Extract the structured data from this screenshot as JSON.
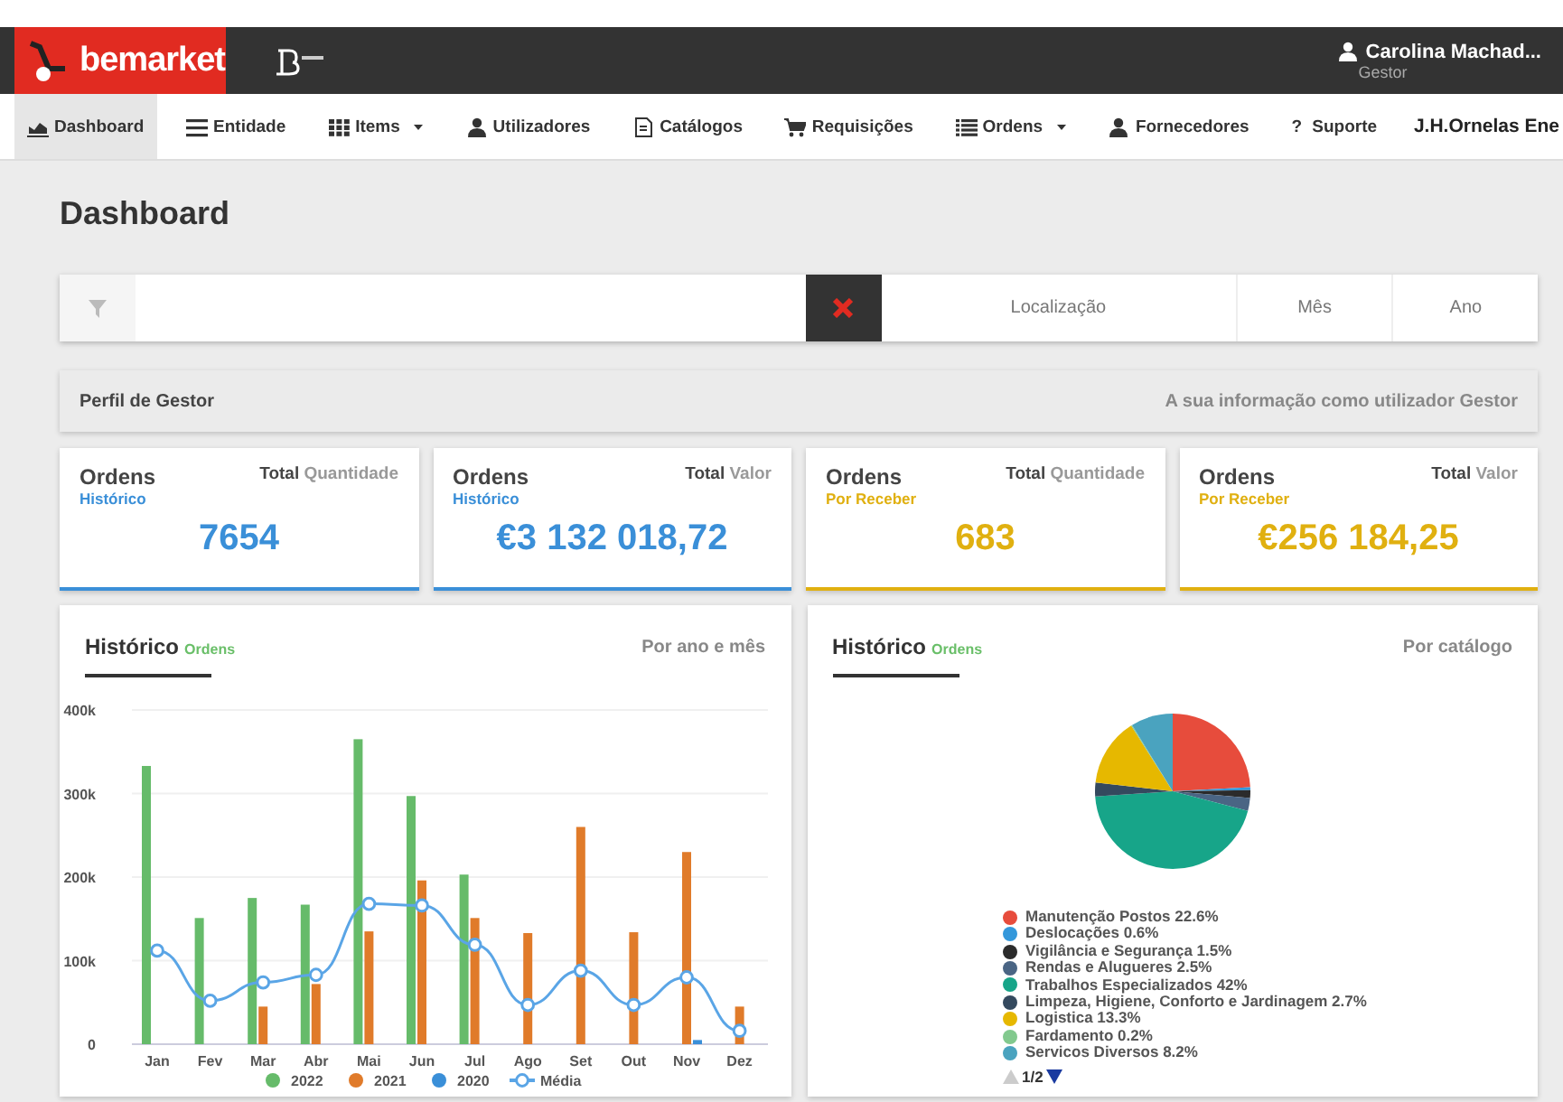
{
  "header": {
    "brand": "bemarket",
    "user": {
      "name": "Carolina Machad...",
      "role": "Gestor"
    }
  },
  "nav": [
    {
      "label": "Dashboard",
      "kind": "chart",
      "selected": true,
      "dropdown": false
    },
    {
      "label": "Entidade",
      "kind": "bars",
      "selected": false,
      "dropdown": false
    },
    {
      "label": "Items",
      "kind": "grid",
      "selected": false,
      "dropdown": true
    },
    {
      "label": "Utilizadores",
      "kind": "user",
      "selected": false,
      "dropdown": false
    },
    {
      "label": "Catálogos",
      "kind": "document",
      "selected": false,
      "dropdown": false
    },
    {
      "label": "Requisições",
      "kind": "cart",
      "selected": false,
      "dropdown": false
    },
    {
      "label": "Ordens",
      "kind": "list",
      "selected": false,
      "dropdown": true
    },
    {
      "label": "Fornecedores",
      "kind": "user",
      "selected": false,
      "dropdown": false
    },
    {
      "label": "Suporte",
      "kind": "glyph",
      "glyph": "?",
      "selected": false,
      "dropdown": false
    },
    {
      "label": "J.H.Ornelas Ene",
      "kind": "account",
      "selected": false,
      "dropdown": false
    }
  ],
  "page_title": "Dashboard",
  "filters": [
    "Localização",
    "Mês",
    "Ano"
  ],
  "profile": {
    "title": "Perfil de Gestor",
    "note": "A sua informação como utilizador Gestor"
  },
  "stats": [
    {
      "title": "Ordens",
      "subtitle": "Histórico",
      "total_label": "Total",
      "measure": "Quantidade",
      "value": "7654",
      "color": "#3a8fd8"
    },
    {
      "title": "Ordens",
      "subtitle": "Histórico",
      "total_label": "Total",
      "measure": "Valor",
      "value": "€3 132 018,72",
      "color": "#3a8fd8"
    },
    {
      "title": "Ordens",
      "subtitle": "Por Receber",
      "total_label": "Total",
      "measure": "Quantidade",
      "value": "683",
      "color": "#e0b010"
    },
    {
      "title": "Ordens",
      "subtitle": "Por Receber",
      "total_label": "Total",
      "measure": "Valor",
      "value": "€256 184,25",
      "color": "#e0b010"
    }
  ],
  "history_chart": {
    "title": "Histórico",
    "tag": "Ordens",
    "note": "Por ano e mês",
    "chart_data": {
      "type": "bar",
      "stacked": false,
      "grid": true,
      "legend": "bottom",
      "categories": [
        "Jan",
        "Fev",
        "Mar",
        "Abr",
        "Mai",
        "Jun",
        "Jul",
        "Ago",
        "Set",
        "Out",
        "Nov",
        "Dez"
      ],
      "ylim": [
        0,
        400000
      ],
      "yticks": [
        {
          "value": 0,
          "label": "0"
        },
        {
          "value": 100000,
          "label": "100k"
        },
        {
          "value": 200000,
          "label": "200k"
        },
        {
          "value": 300000,
          "label": "300k"
        },
        {
          "value": 400000,
          "label": "400k"
        }
      ],
      "series": [
        {
          "name": "2022",
          "color": "#66bb6a",
          "values": [
            333000,
            151000,
            175000,
            167000,
            365000,
            297000,
            203000,
            null,
            null,
            null,
            null,
            null
          ]
        },
        {
          "name": "2021",
          "color": "#e07b2a",
          "values": [
            null,
            null,
            45000,
            72000,
            135000,
            196000,
            151000,
            133000,
            260000,
            134000,
            230000,
            45000
          ]
        },
        {
          "name": "2020",
          "color": "#3a8fd8",
          "values": [
            null,
            null,
            null,
            null,
            null,
            null,
            null,
            null,
            null,
            null,
            5000,
            null
          ]
        },
        {
          "name": "Média",
          "color": "#5aa5e6",
          "type": "line",
          "marker": "circle",
          "values": [
            112000,
            52000,
            74000,
            83000,
            168000,
            166000,
            119000,
            47000,
            88000,
            47000,
            80000,
            16000
          ]
        }
      ]
    }
  },
  "catalog_chart": {
    "title": "Histórico",
    "tag": "Ordens",
    "note": "Por catálogo",
    "page": "1/2",
    "chart_data": {
      "type": "pie",
      "legend": "bottom",
      "categories": [
        "Manutenção Postos 22.6%",
        "Deslocações 0.6%",
        "Vigilância e Segurança 1.5%",
        "Rendas e Alugueres 2.5%",
        "Trabalhos Especializados 42%",
        "Limpeza, Higiene, Conforto e Jardinagem 2.7%",
        "Logistica 13.3%",
        "Fardamento 0.2%",
        "Servicos Diversos 8.2%"
      ],
      "values": [
        22.6,
        0.6,
        1.5,
        2.5,
        42,
        2.7,
        13.3,
        0.2,
        8.2
      ],
      "colors": [
        "#e74c3c",
        "#3498db",
        "#2b2b2b",
        "#4a6584",
        "#17a589",
        "#34495e",
        "#e6b800",
        "#82c98e",
        "#4aa3bf"
      ]
    }
  }
}
